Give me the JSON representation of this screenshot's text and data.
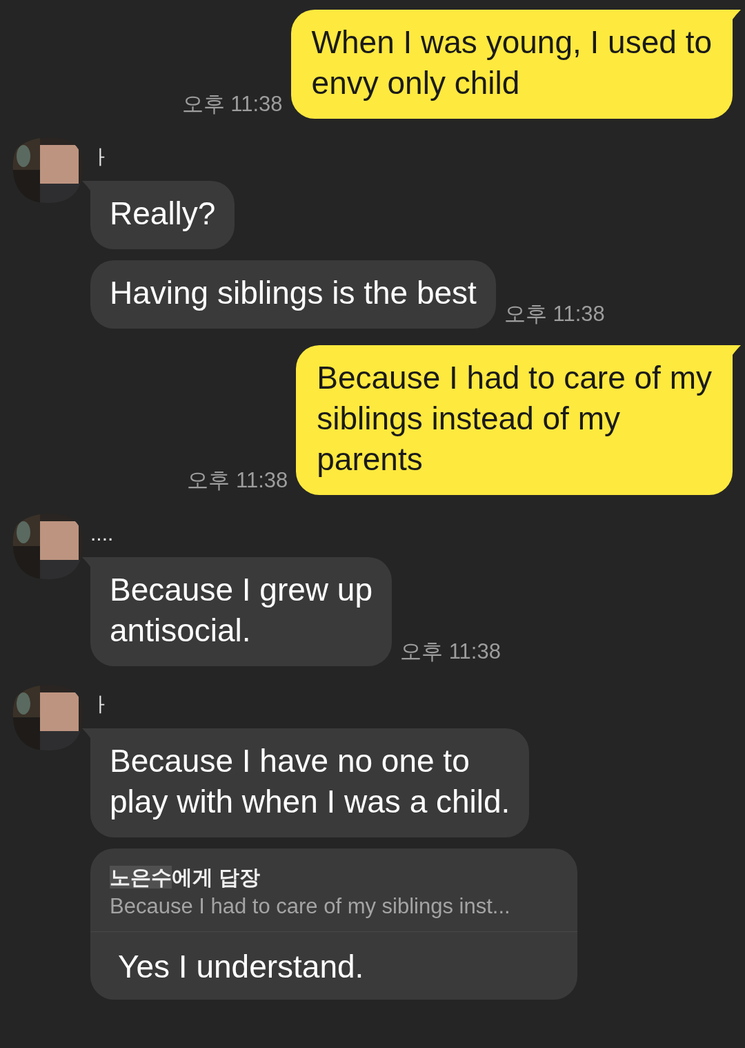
{
  "messages": [
    {
      "kind": "sent",
      "text": "When I was young, I used to\nenvy only child",
      "time": "오후 11:38"
    },
    {
      "kind": "received",
      "name": "ㅏ",
      "bubbles": [
        {
          "text": "Really?"
        },
        {
          "text": "Having siblings is the best",
          "time": "오후 11:38"
        }
      ]
    },
    {
      "kind": "sent",
      "text": "Because I had to care of my\nsiblings instead of my\nparents",
      "time": "오후 11:38"
    },
    {
      "kind": "received",
      "name": "....",
      "bubbles": [
        {
          "text": "Because I grew up\nantisocial.",
          "time": "오후 11:38"
        }
      ]
    },
    {
      "kind": "received",
      "name": "ㅏ",
      "bubbles": [
        {
          "text": "Because I have no one to\nplay with when I was a child."
        },
        {
          "reply_to": {
            "name": "노은수",
            "suffix": "에게 답장",
            "quote": "Because I had to care of my siblings inst..."
          },
          "text": "Yes I understand."
        }
      ]
    }
  ]
}
